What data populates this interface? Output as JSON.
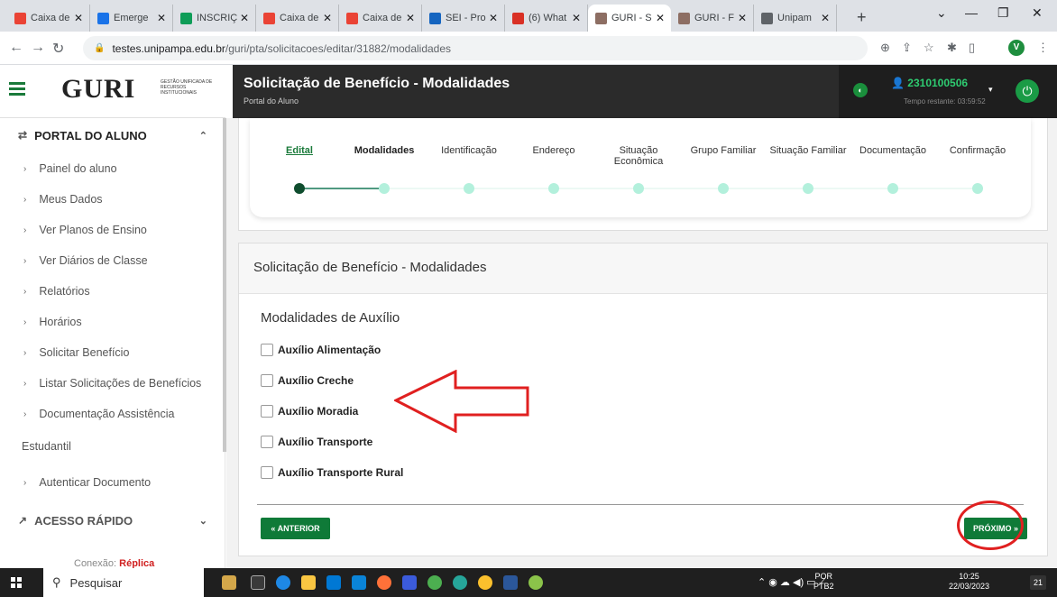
{
  "browser": {
    "tabs": [
      {
        "label": "Caixa de",
        "favicon_color": "#ea4335"
      },
      {
        "label": "Emerge",
        "favicon_color": "#1a73e8"
      },
      {
        "label": "INSCRIÇ",
        "favicon_color": "#0f9d58"
      },
      {
        "label": "Caixa de",
        "favicon_color": "#ea4335"
      },
      {
        "label": "Caixa de",
        "favicon_color": "#ea4335"
      },
      {
        "label": "SEI - Pro",
        "favicon_color": "#1565c0"
      },
      {
        "label": "(6) What",
        "favicon_color": "#d93025"
      },
      {
        "label": "GURI - S",
        "favicon_color": "#8d6e63"
      },
      {
        "label": "GURI - F",
        "favicon_color": "#8d6e63"
      },
      {
        "label": "Unipam",
        "favicon_color": "#5f6368"
      }
    ],
    "active_tab_index": 7,
    "url_host": "testes.unipampa.edu.br",
    "url_path": "/guri/pta/solicitacoes/editar/31882/modalidades",
    "profile_initial": "V"
  },
  "header": {
    "logo_text": "GURI",
    "logo_sub": "GESTÃO UNIFICADA DE RECURSOS INSTITUCIONAIS",
    "page_title": "Solicitação de Benefício - Modalidades",
    "page_subtitle": "Portal do Aluno",
    "user_id": "2310100506",
    "timer_text": "Tempo restante: 03:59:52"
  },
  "sidebar": {
    "section_title": "PORTAL DO ALUNO",
    "items": [
      {
        "label": "Painel do aluno"
      },
      {
        "label": "Meus Dados"
      },
      {
        "label": "Ver Planos de Ensino"
      },
      {
        "label": "Ver Diários de Classe"
      },
      {
        "label": "Relatórios"
      },
      {
        "label": "Horários"
      },
      {
        "label": "Solicitar Benefício"
      },
      {
        "label": "Listar Solicitações de Benefícios"
      },
      {
        "label": "Documentação Assistência"
      }
    ],
    "wrapped_text": "Estudantil",
    "item_after": "Autenticar Documento",
    "quick_access": "ACESSO RÁPIDO",
    "connection_label": "Conexão:",
    "connection_value": "Réplica"
  },
  "stepper": {
    "steps": [
      {
        "label": "Edital",
        "state": "done"
      },
      {
        "label": "Modalidades",
        "state": "current"
      },
      {
        "label": "Identificação",
        "state": "todo"
      },
      {
        "label": "Endereço",
        "state": "todo"
      },
      {
        "label": "Situação Econômica",
        "state": "todo"
      },
      {
        "label": "Grupo Familiar",
        "state": "todo"
      },
      {
        "label": "Situação Familiar",
        "state": "todo"
      },
      {
        "label": "Documentação",
        "state": "todo"
      },
      {
        "label": "Confirmação",
        "state": "todo"
      }
    ]
  },
  "form": {
    "title": "Solicitação de Benefício - Modalidades",
    "group_title": "Modalidades de Auxílio",
    "options": [
      {
        "label": "Auxílio Alimentação",
        "checked": false
      },
      {
        "label": "Auxílio Creche",
        "checked": false
      },
      {
        "label": "Auxílio Moradia",
        "checked": false
      },
      {
        "label": "Auxílio Transporte",
        "checked": false
      },
      {
        "label": "Auxílio Transporte Rural",
        "checked": false
      }
    ],
    "prev_label": "« ANTERIOR",
    "next_label": "PRÓXIMO »"
  },
  "taskbar": {
    "search_placeholder": "Pesquisar",
    "lang_line1": "POR",
    "lang_line2": "PTB2",
    "time": "10:25",
    "date": "22/03/2023",
    "notif_count": "21"
  },
  "colors": {
    "accent_green": "#0f7a38",
    "annotation_red": "#e02020"
  }
}
